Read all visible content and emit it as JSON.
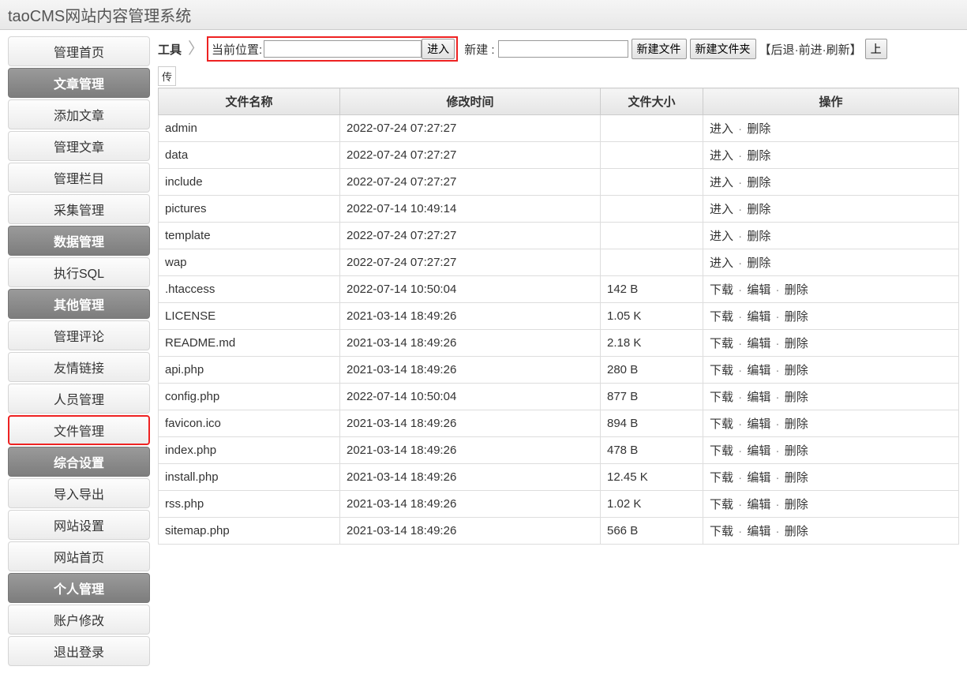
{
  "header": {
    "title": "taoCMS网站内容管理系统"
  },
  "sidebar": [
    {
      "label": "管理首页",
      "type": "item"
    },
    {
      "label": "文章管理",
      "type": "section"
    },
    {
      "label": "添加文章",
      "type": "item"
    },
    {
      "label": "管理文章",
      "type": "item"
    },
    {
      "label": "管理栏目",
      "type": "item"
    },
    {
      "label": "采集管理",
      "type": "item"
    },
    {
      "label": "数据管理",
      "type": "section"
    },
    {
      "label": "执行SQL",
      "type": "item"
    },
    {
      "label": "其他管理",
      "type": "section"
    },
    {
      "label": "管理评论",
      "type": "item"
    },
    {
      "label": "友情链接",
      "type": "item"
    },
    {
      "label": "人员管理",
      "type": "item"
    },
    {
      "label": "文件管理",
      "type": "item",
      "highlighted": true
    },
    {
      "label": "综合设置",
      "type": "section"
    },
    {
      "label": "导入导出",
      "type": "item"
    },
    {
      "label": "网站设置",
      "type": "item"
    },
    {
      "label": "网站首页",
      "type": "item"
    },
    {
      "label": "个人管理",
      "type": "section"
    },
    {
      "label": "账户修改",
      "type": "item"
    },
    {
      "label": "退出登录",
      "type": "item"
    }
  ],
  "toolbar": {
    "tool_label": "工具",
    "path_label": "当前位置:",
    "path_value": "",
    "enter_btn": "进入",
    "new_label": "新建 :",
    "new_value": "",
    "new_file_btn": "新建文件",
    "new_folder_btn": "新建文件夹",
    "nav_back": "后退",
    "nav_forward": "前进",
    "nav_refresh": "刷新",
    "up_btn": "上",
    "upload_label": "传"
  },
  "table": {
    "headers": {
      "name": "文件名称",
      "time": "修改时间",
      "size": "文件大小",
      "ops": "操作"
    },
    "dir_ops": {
      "enter": "进入",
      "delete": "删除"
    },
    "file_ops": {
      "download": "下载",
      "edit": "编辑",
      "delete": "删除"
    },
    "rows": [
      {
        "name": "admin",
        "time": "2022-07-24 07:27:27",
        "size": "",
        "type": "dir"
      },
      {
        "name": "data",
        "time": "2022-07-24 07:27:27",
        "size": "",
        "type": "dir"
      },
      {
        "name": "include",
        "time": "2022-07-24 07:27:27",
        "size": "",
        "type": "dir"
      },
      {
        "name": "pictures",
        "time": "2022-07-14 10:49:14",
        "size": "",
        "type": "dir"
      },
      {
        "name": "template",
        "time": "2022-07-24 07:27:27",
        "size": "",
        "type": "dir"
      },
      {
        "name": "wap",
        "time": "2022-07-24 07:27:27",
        "size": "",
        "type": "dir"
      },
      {
        "name": ".htaccess",
        "time": "2022-07-14 10:50:04",
        "size": "142 B",
        "type": "file"
      },
      {
        "name": "LICENSE",
        "time": "2021-03-14 18:49:26",
        "size": "1.05 K",
        "type": "file"
      },
      {
        "name": "README.md",
        "time": "2021-03-14 18:49:26",
        "size": "2.18 K",
        "type": "file"
      },
      {
        "name": "api.php",
        "time": "2021-03-14 18:49:26",
        "size": "280 B",
        "type": "file"
      },
      {
        "name": "config.php",
        "time": "2022-07-14 10:50:04",
        "size": "877 B",
        "type": "file"
      },
      {
        "name": "favicon.ico",
        "time": "2021-03-14 18:49:26",
        "size": "894 B",
        "type": "file"
      },
      {
        "name": "index.php",
        "time": "2021-03-14 18:49:26",
        "size": "478 B",
        "type": "file"
      },
      {
        "name": "install.php",
        "time": "2021-03-14 18:49:26",
        "size": "12.45 K",
        "type": "file"
      },
      {
        "name": "rss.php",
        "time": "2021-03-14 18:49:26",
        "size": "1.02 K",
        "type": "file"
      },
      {
        "name": "sitemap.php",
        "time": "2021-03-14 18:49:26",
        "size": "566 B",
        "type": "file"
      }
    ]
  }
}
